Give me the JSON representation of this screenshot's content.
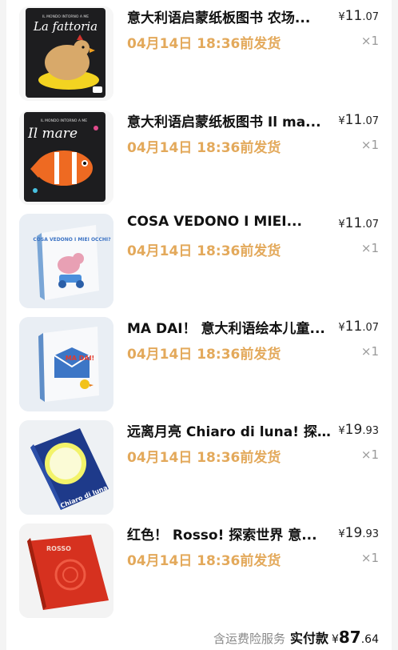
{
  "items": [
    {
      "title": "意大利语启蒙纸板图书 农场...",
      "price_currency": "¥",
      "price_int": "11",
      "price_dec": ".07",
      "ship_time": "04月14日 18:36前发货",
      "quantity": "×1",
      "cover": {
        "icon": "book-cover-la-fattoria-icon",
        "text": "La fattoria",
        "top_text": "IL MONDO INTORNO A ME"
      }
    },
    {
      "title": "意大利语启蒙纸板图书 Il ma...",
      "price_currency": "¥",
      "price_int": "11",
      "price_dec": ".07",
      "ship_time": "04月14日 18:36前发货",
      "quantity": "×1",
      "cover": {
        "icon": "book-cover-il-mare-icon",
        "text": "Il mare",
        "top_text": "IL MONDO INTORNO A ME"
      }
    },
    {
      "title": "COSA VEDONO I MIEI...",
      "price_currency": "¥",
      "price_int": "11",
      "price_dec": ".07",
      "ship_time": "04月14日 18:36前发货",
      "quantity": "×1",
      "cover": {
        "icon": "book-cover-cosa-vedono-icon",
        "text": "COSA VEDONO I MIEI OCCHI?"
      }
    },
    {
      "title": "MA DAI！ 意大利语绘本儿童...",
      "price_currency": "¥",
      "price_int": "11",
      "price_dec": ".07",
      "ship_time": "04月14日 18:36前发货",
      "quantity": "×1",
      "cover": {
        "icon": "book-cover-ma-dai-icon",
        "text": "MA DAI!"
      }
    },
    {
      "title": "远离月亮 Chiaro di luna! 探...",
      "price_currency": "¥",
      "price_int": "19",
      "price_dec": ".93",
      "ship_time": "04月14日 18:36前发货",
      "quantity": "×1",
      "cover": {
        "icon": "book-cover-chiaro-di-luna-icon",
        "text": "Chiaro di luna"
      }
    },
    {
      "title": "红色！ Rosso! 探索世界 意...",
      "price_currency": "¥",
      "price_int": "19",
      "price_dec": ".93",
      "ship_time": "04月14日 18:36前发货",
      "quantity": "×1",
      "cover": {
        "icon": "book-cover-rosso-icon",
        "text": "ROSSO"
      }
    }
  ],
  "footer": {
    "note": "含运费险服务",
    "label": "实付款",
    "currency": "¥",
    "total_int": "87",
    "total_dec": ".64"
  },
  "colors": {
    "ship_time": "#e3a95b",
    "background": "#f4f4f4",
    "card": "#ffffff"
  }
}
